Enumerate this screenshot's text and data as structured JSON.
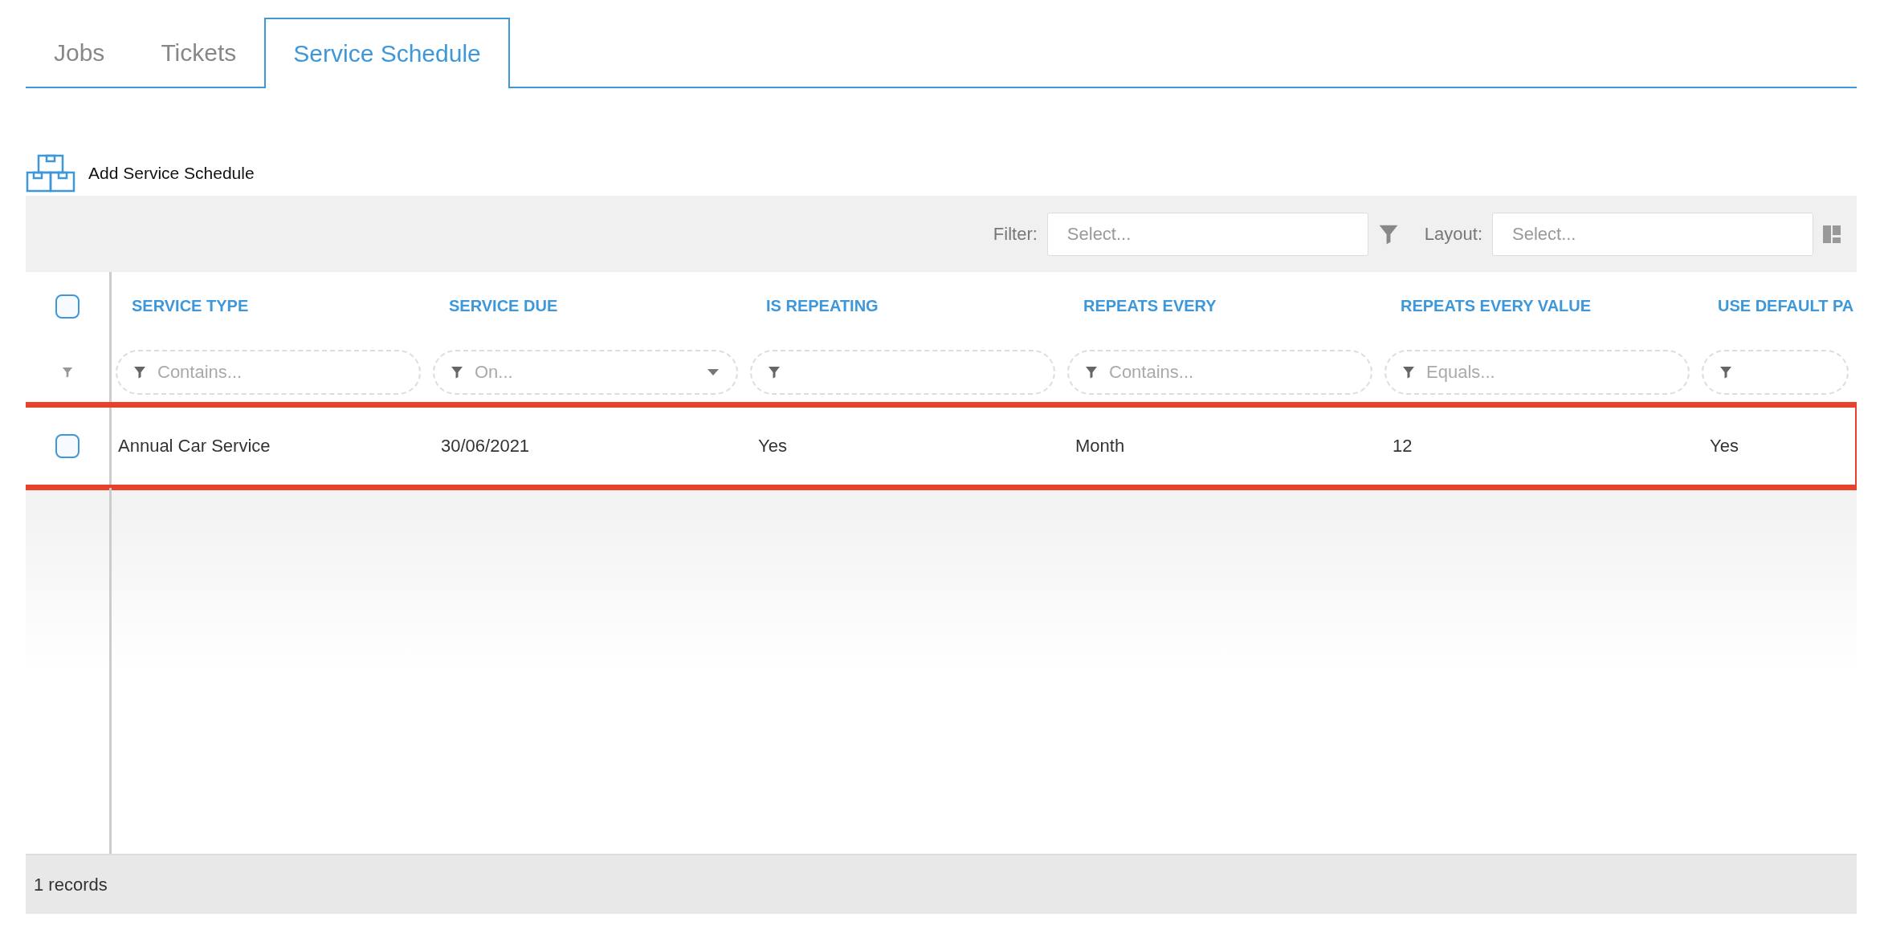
{
  "tabs": [
    {
      "label": "Jobs",
      "selected": false
    },
    {
      "label": "Tickets",
      "selected": false
    },
    {
      "label": "Service Schedule",
      "selected": true
    }
  ],
  "add_button": {
    "label": "Add Service Schedule"
  },
  "toolbar": {
    "filter": {
      "label": "Filter:",
      "placeholder": "Select..."
    },
    "layout": {
      "label": "Layout:",
      "placeholder": "Select..."
    }
  },
  "table": {
    "select_all": {
      "checked": false
    },
    "columns": [
      {
        "title": "SERVICE TYPE",
        "filter": {
          "kind": "text",
          "placeholder": "Contains..."
        }
      },
      {
        "title": "SERVICE DUE",
        "filter": {
          "kind": "date",
          "placeholder": "On..."
        }
      },
      {
        "title": "IS REPEATING",
        "filter": {
          "kind": "bool"
        }
      },
      {
        "title": "REPEATS EVERY",
        "filter": {
          "kind": "text",
          "placeholder": "Contains..."
        }
      },
      {
        "title": "REPEATS EVERY VALUE",
        "filter": {
          "kind": "text",
          "placeholder": "Equals..."
        }
      },
      {
        "title": "USE DEFAULT PA",
        "filter": {
          "kind": "bool"
        }
      }
    ],
    "rows": [
      {
        "checked": false,
        "highlighted": true,
        "cells": [
          "Annual Car Service",
          "30/06/2021",
          "Yes",
          "Month",
          "12",
          "Yes"
        ]
      }
    ]
  },
  "status_bar": {
    "records": "1 records"
  }
}
